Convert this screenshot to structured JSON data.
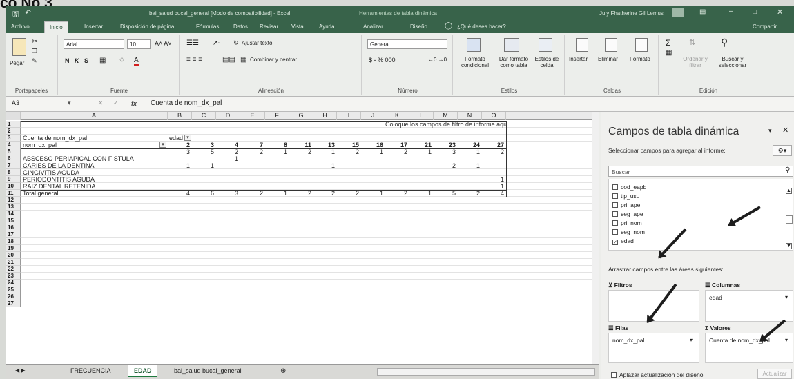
{
  "doc_heading": "co No 3",
  "window": {
    "title": "bai_salud bucal_general [Modo de compatibilidad] - Excel",
    "context_tools": "Herramientas de tabla dinámica",
    "user": "July Fhatherine Gil Lemus"
  },
  "ribbon_tabs": [
    "Archivo",
    "Inicio",
    "Insertar",
    "Disposición de página",
    "Fórmulas",
    "Datos",
    "Revisar",
    "Vista",
    "Ayuda",
    "Analizar",
    "Diseño"
  ],
  "tell_me": "¿Qué desea hacer?",
  "share": "Compartir",
  "ribbon": {
    "clipboard": {
      "paste": "Pegar",
      "label": "Portapapeles"
    },
    "font": {
      "name": "Arial",
      "size": "10",
      "label": "Fuente",
      "bold": "N",
      "italic": "K",
      "underline": "S"
    },
    "alignment": {
      "wrap": "Ajustar texto",
      "merge": "Combinar y centrar",
      "label": "Alineación"
    },
    "number": {
      "format": "General",
      "currency": "$ - % 000",
      "label": "Número"
    },
    "styles": {
      "cond": "Formato condicional",
      "table": "Dar formato como tabla",
      "cell": "Estilos de celda",
      "label": "Estilos"
    },
    "cells": {
      "insert": "Insertar",
      "delete": "Eliminar",
      "format": "Formato",
      "label": "Celdas"
    },
    "editing": {
      "sort": "Ordenar y filtrar",
      "find": "Buscar y seleccionar",
      "label": "Edición"
    }
  },
  "formula_bar": {
    "name_box": "A3",
    "fx": "fx",
    "content": "Cuenta de nom_dx_pal"
  },
  "columns": [
    "A",
    "B",
    "C",
    "D",
    "E",
    "F",
    "G",
    "H",
    "I",
    "J",
    "K",
    "L",
    "M",
    "N",
    "O"
  ],
  "rows": [
    "1",
    "2",
    "3",
    "4",
    "5",
    "6",
    "7",
    "8",
    "9",
    "10",
    "11",
    "12",
    "13",
    "14",
    "15",
    "16",
    "17",
    "18",
    "19",
    "20",
    "21",
    "22",
    "23",
    "24",
    "25",
    "26",
    "27"
  ],
  "pivot": {
    "filter_hint": "Coloque los campos de filtro de informe aquí",
    "values_label": "Cuenta de nom_dx_pal",
    "col_field": "edad",
    "row_field": "nom_dx_pal",
    "ages": [
      "2",
      "3",
      "4",
      "7",
      "8",
      "11",
      "13",
      "15",
      "16",
      "17",
      "21",
      "23",
      "24",
      "27"
    ],
    "blank_row": [
      "3",
      "5",
      "2",
      "2",
      "1",
      "2",
      "1",
      "2",
      "1",
      "2",
      "1",
      "3",
      "1",
      "2"
    ],
    "data_rows": [
      {
        "label": "ABSCESO PERIAPICAL CON FISTULA",
        "values": [
          "",
          "",
          "1",
          "",
          "",
          "",
          "",
          "",
          "",
          "",
          "",
          "",
          "",
          ""
        ]
      },
      {
        "label": "CARIES DE LA DENTINA",
        "values": [
          "1",
          "1",
          "",
          "",
          "",
          "",
          "1",
          "",
          "",
          "",
          "",
          "2",
          "1",
          ""
        ]
      },
      {
        "label": "GINGIVITIS AGUDA",
        "values": [
          "",
          "",
          "",
          "",
          "",
          "",
          "",
          "",
          "",
          "",
          "",
          "",
          "",
          ""
        ]
      },
      {
        "label": "PERIODONTITIS AGUDA",
        "values": [
          "",
          "",
          "",
          "",
          "",
          "",
          "",
          "",
          "",
          "",
          "",
          "",
          "",
          "1"
        ]
      },
      {
        "label": "RAIZ DENTAL RETENIDA",
        "values": [
          "",
          "",
          "",
          "",
          "",
          "",
          "",
          "",
          "",
          "",
          "",
          "",
          "",
          "1"
        ]
      }
    ],
    "total_label": "Total general",
    "totals": [
      "4",
      "6",
      "3",
      "2",
      "1",
      "2",
      "2",
      "2",
      "1",
      "2",
      "1",
      "5",
      "2",
      "4"
    ]
  },
  "sheet_tabs": [
    "FRECUENCIA",
    "EDAD",
    "bai_salud bucal_general"
  ],
  "panel": {
    "title": "Campos de tabla dinámica",
    "subtitle": "Seleccionar campos para agregar al informe:",
    "search_placeholder": "Buscar",
    "fields": [
      {
        "name": "cod_eapb",
        "checked": false
      },
      {
        "name": "tip_usu",
        "checked": false
      },
      {
        "name": "pri_ape",
        "checked": false
      },
      {
        "name": "seg_ape",
        "checked": false
      },
      {
        "name": "pri_nom",
        "checked": false
      },
      {
        "name": "seg_nom",
        "checked": false
      },
      {
        "name": "edad",
        "checked": true
      }
    ],
    "drag_hint": "Arrastrar campos entre las áreas siguientes:",
    "filters_label": "Filtros",
    "columns_label": "Columnas",
    "columns_value": "edad",
    "rows_label": "Filas",
    "rows_value": "nom_dx_pal",
    "values_label": "Valores",
    "values_value": "Cuenta de nom_dx_pal",
    "defer": "Aplazar actualización del diseño",
    "update": "Actualizar"
  }
}
